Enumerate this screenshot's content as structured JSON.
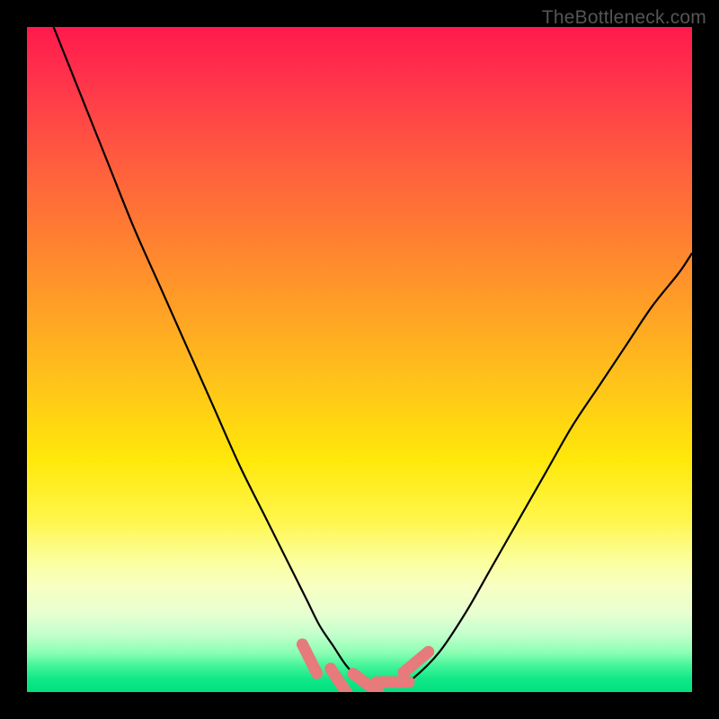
{
  "watermark": "TheBottleneck.com",
  "chart_data": {
    "type": "line",
    "title": "",
    "xlabel": "",
    "ylabel": "",
    "xlim": [
      0,
      100
    ],
    "ylim": [
      0,
      100
    ],
    "series": [
      {
        "name": "bottleneck-curve",
        "x": [
          4,
          8,
          12,
          16,
          20,
          24,
          28,
          32,
          36,
          40,
          42,
          44,
          46,
          48,
          50,
          52,
          54,
          56,
          58,
          62,
          66,
          70,
          74,
          78,
          82,
          86,
          90,
          94,
          98,
          100
        ],
        "values": [
          100,
          90,
          80,
          70,
          61,
          52,
          43,
          34,
          26,
          18,
          14,
          10,
          7,
          4,
          2,
          1,
          1,
          1,
          2,
          6,
          12,
          19,
          26,
          33,
          40,
          46,
          52,
          58,
          63,
          66
        ]
      }
    ],
    "markers": [
      {
        "name": "marker-left-end",
        "x": 42.5,
        "y": 5.0
      },
      {
        "name": "marker-bottom-1",
        "x": 47.0,
        "y": 1.5
      },
      {
        "name": "marker-bottom-2",
        "x": 51.0,
        "y": 1.3
      },
      {
        "name": "marker-bottom-3",
        "x": 55.0,
        "y": 1.5
      },
      {
        "name": "marker-right-end",
        "x": 58.5,
        "y": 4.5
      }
    ],
    "colors": {
      "curve": "#000000",
      "marker": "#e77a7a",
      "frame": "#000000"
    }
  }
}
